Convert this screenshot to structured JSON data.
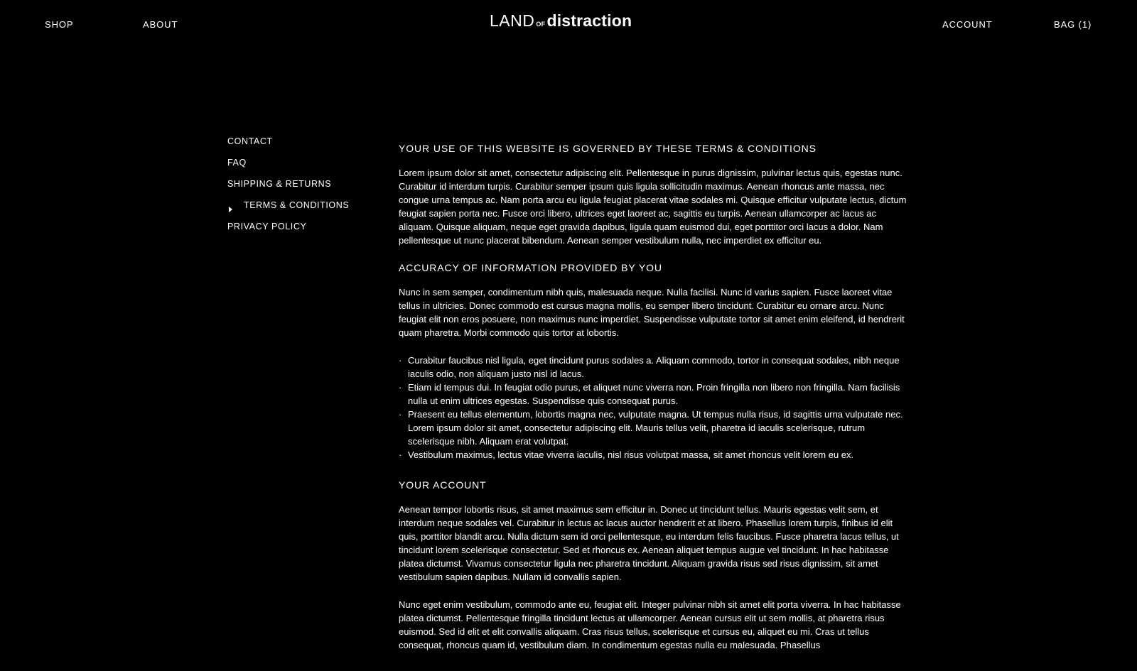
{
  "header": {
    "nav_left": [
      {
        "label": "SHOP"
      },
      {
        "label": "ABOUT"
      }
    ],
    "logo": {
      "part1": "LAND",
      "part2": "OF",
      "part3": "distraction"
    },
    "nav_right": [
      {
        "label": "ACCOUNT"
      },
      {
        "label": "BAG  (1)"
      }
    ]
  },
  "sidebar": {
    "items": [
      {
        "label": "CONTACT"
      },
      {
        "label": "FAQ"
      },
      {
        "label": "SHIPPING & RETURNS"
      },
      {
        "label": "TERMS & CONDITIONS",
        "active": true
      },
      {
        "label": "PRIVACY POLICY"
      }
    ]
  },
  "content": {
    "sections": [
      {
        "title": "YOUR USE OF THIS WEBSITE IS GOVERNED BY THESE TERMS & CONDITIONS",
        "paragraphs": [
          "Lorem ipsum dolor sit amet, consectetur adipiscing elit. Pellentesque in purus dignissim, pulvinar lectus quis, egestas nunc. Curabitur id interdum turpis. Curabitur semper ipsum quis ligula sollicitudin maximus. Aenean rhoncus ante massa, nec congue urna tempus ac. Nam porta arcu eu ligula feugiat placerat vitae sodales mi. Quisque efficitur vulputate lectus, dictum feugiat sapien porta nec. Fusce orci libero, ultrices eget laoreet ac, sagittis eu turpis. Aenean ullamcorper ac lacus ac aliquam. Quisque aliquam, neque eget gravida dapibus, ligula quam euismod dui, eget porttitor orci lacus a dolor. Nam pellentesque ut nunc placerat bibendum. Aenean semper vestibulum nulla, nec imperdiet ex efficitur eu."
        ]
      },
      {
        "title": "ACCURACY OF INFORMATION PROVIDED BY YOU",
        "paragraphs": [
          "Nunc in sem semper, condimentum nibh quis, malesuada neque. Nulla facilisi. Nunc id varius sapien. Fusce laoreet vitae tellus in ultricies. Donec commodo est cursus magna mollis, eu semper libero tincidunt. Curabitur eu ornare arcu. Nunc feugiat elit non eros posuere, non maximus nunc imperdiet. Suspendisse vulputate tortor sit amet enim eleifend, id hendrerit quam pharetra. Morbi commodo quis tortor at lobortis."
        ],
        "bullets": [
          "Curabitur faucibus nisl ligula, eget tincidunt purus sodales a. Aliquam commodo, tortor in consequat sodales, nibh neque iaculis odio, non aliquam justo nisl id lacus.",
          "Etiam id tempus dui. In feugiat odio purus, et aliquet nunc viverra non. Proin fringilla non libero non fringilla. Nam facilisis nulla ut enim ultrices egestas. Suspendisse quis consequat purus.",
          "Praesent eu tellus elementum, lobortis magna nec, vulputate magna. Ut tempus nulla risus, id sagittis urna vulputate nec. Lorem ipsum dolor sit amet, consectetur adipiscing elit. Mauris tellus velit, pharetra id iaculis scelerisque, rutrum scelerisque nibh. Aliquam erat volutpat.",
          "Vestibulum maximus, lectus vitae viverra iaculis, nisl risus volutpat massa, sit amet rhoncus velit lorem eu ex."
        ]
      },
      {
        "title": "YOUR ACCOUNT",
        "paragraphs": [
          "Aenean tempor lobortis risus, sit amet maximus sem efficitur in. Donec ut tincidunt tellus. Mauris egestas velit sem, et interdum neque sodales vel. Curabitur in lectus ac lacus auctor hendrerit et at libero. Phasellus lorem turpis, finibus id elit quis, porttitor blandit arcu. Nulla dictum sem id orci pellentesque, eu interdum felis faucibus. Fusce pharetra lacus tellus, ut tincidunt lorem scelerisque consectetur. Sed et rhoncus ex. Aenean aliquet tempus augue vel tincidunt. In hac habitasse platea dictumst. Vivamus consectetur ligula nec pharetra tincidunt. Aliquam gravida risus sed risus dignissim, sit amet vestibulum sapien dapibus. Nullam id convallis sapien.",
          "Nunc eget enim vestibulum, commodo ante eu, feugiat elit. Integer pulvinar nibh sit amet elit porta viverra. In hac habitasse platea dictumst. Pellentesque fringilla tincidunt lectus at ullamcorper. Aenean cursus elit ut sem mollis, at pharetra risus euismod. Sed id elit et elit convallis aliquam. Cras risus tellus, scelerisque et cursus eu, aliquet eu mi. Cras ut tellus consequat, rhoncus quam id, vestibulum diam. In condimentum egestas nulla eu malesuada. Phasellus"
        ]
      }
    ]
  },
  "colors": {
    "background": "#000000",
    "text": "#ffffff"
  }
}
